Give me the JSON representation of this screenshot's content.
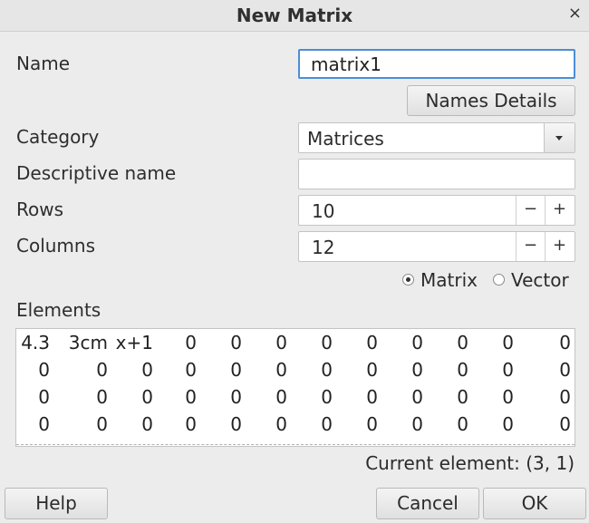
{
  "window": {
    "title": "New Matrix",
    "close_glyph": "×"
  },
  "name": {
    "label": "Name",
    "value": "matrix1"
  },
  "names_details_button": "Names Details",
  "category": {
    "label": "Category",
    "value": "Matrices"
  },
  "descriptive_name": {
    "label": "Descriptive name",
    "value": ""
  },
  "rows": {
    "label": "Rows",
    "value": "10",
    "minus": "−",
    "plus": "+"
  },
  "columns": {
    "label": "Columns",
    "value": "12",
    "minus": "−",
    "plus": "+"
  },
  "type_options": [
    {
      "label": "Matrix",
      "selected": true
    },
    {
      "label": "Vector",
      "selected": false
    }
  ],
  "elements": {
    "label": "Elements",
    "rows": [
      [
        "4.3",
        "3cm",
        "x+1",
        "0",
        "0",
        "0",
        "0",
        "0",
        "0",
        "0",
        "0",
        "0"
      ],
      [
        "0",
        "0",
        "0",
        "0",
        "0",
        "0",
        "0",
        "0",
        "0",
        "0",
        "0",
        "0"
      ],
      [
        "0",
        "0",
        "0",
        "0",
        "0",
        "0",
        "0",
        "0",
        "0",
        "0",
        "0",
        "0"
      ],
      [
        "0",
        "0",
        "0",
        "0",
        "0",
        "0",
        "0",
        "0",
        "0",
        "0",
        "0",
        "0"
      ]
    ]
  },
  "status": {
    "current_element": "Current element: (3, 1)"
  },
  "buttons": {
    "help": "Help",
    "cancel": "Cancel",
    "ok": "OK"
  }
}
